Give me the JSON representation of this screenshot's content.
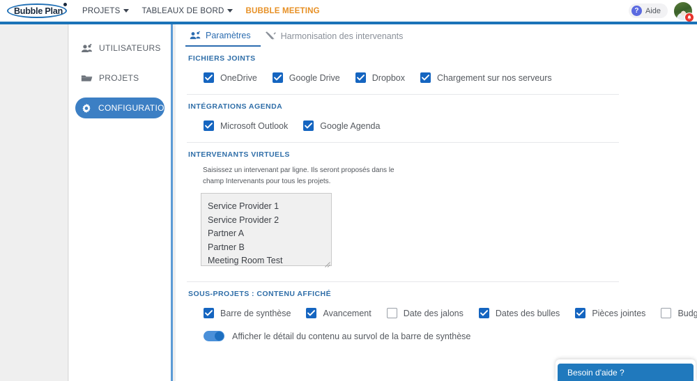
{
  "header": {
    "logo_text": "Bubble Plan",
    "nav": [
      {
        "label": "PROJETS",
        "has_caret": true,
        "accent": false
      },
      {
        "label": "TABLEAUX DE BORD",
        "has_caret": true,
        "accent": false
      },
      {
        "label": "BUBBLE MEETING",
        "has_caret": false,
        "accent": true
      }
    ],
    "help_label": "Aide",
    "help_icon": "question-mark-icon",
    "avatar_icon": "user-avatar",
    "avatar_badge_icon": "bell-icon",
    "accent_color": "#e79025",
    "brand_blue": "#1a73b8"
  },
  "sidebar": {
    "items": [
      {
        "label": "UTILISATEURS",
        "icon": "users-icon",
        "active": false
      },
      {
        "label": "PROJETS",
        "icon": "folder-icon",
        "active": false
      },
      {
        "label": "CONFIGURATION",
        "icon": "gear-icon",
        "active": true
      }
    ],
    "active_color": "#3c7fc4"
  },
  "main": {
    "tabs": [
      {
        "label": "Paramètres",
        "icon": "users-settings-icon",
        "active": true
      },
      {
        "label": "Harmonisation des intervenants",
        "icon": "tools-icon",
        "active": false
      }
    ],
    "sections": {
      "attachments": {
        "title": "FICHIERS JOINTS",
        "options": [
          {
            "label": "OneDrive",
            "checked": true
          },
          {
            "label": "Google Drive",
            "checked": true
          },
          {
            "label": "Dropbox",
            "checked": true
          },
          {
            "label": "Chargement sur nos serveurs",
            "checked": true
          }
        ]
      },
      "calendar": {
        "title": "INTÉGRATIONS AGENDA",
        "options": [
          {
            "label": "Microsoft Outlook",
            "checked": true
          },
          {
            "label": "Google Agenda",
            "checked": true
          }
        ]
      },
      "virtual_participants": {
        "title": "INTERVENANTS VIRTUELS",
        "help_text": "Saisissez un intervenant par ligne. Ils seront proposés dans le champ Intervenants pour tous les projets.",
        "textarea_value": "Service Provider 1\nService Provider 2\nPartner A\nPartner B\nMeeting Room Test",
        "lines": [
          "Service Provider 1",
          "Service Provider 2",
          "Partner A",
          "Partner B",
          "Meeting Room Test"
        ]
      },
      "subprojects": {
        "title": "SOUS-PROJETS : CONTENU AFFICHÉ",
        "options": [
          {
            "label": "Barre de synthèse",
            "checked": true
          },
          {
            "label": "Avancement",
            "checked": true
          },
          {
            "label": "Date des jalons",
            "checked": false
          },
          {
            "label": "Dates des bulles",
            "checked": true
          },
          {
            "label": "Pièces jointes",
            "checked": true
          },
          {
            "label": "Budget",
            "checked": false
          }
        ],
        "toggle": {
          "label": "Afficher le détail du contenu au survol de la barre de synthèse",
          "on": true
        }
      }
    }
  },
  "need_help": {
    "label": "Besoin d'aide ?",
    "color": "#2079bd"
  }
}
